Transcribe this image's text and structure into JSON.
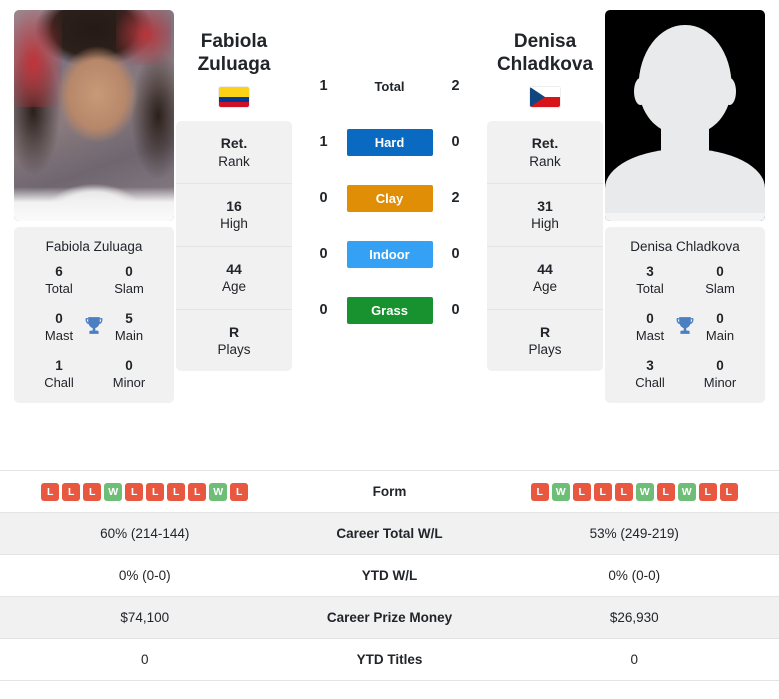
{
  "players": {
    "left": {
      "first_name": "Fabiola",
      "last_name": "Zuluaga",
      "full_name": "Fabiola Zuluaga",
      "flag": "colombia-flag",
      "photo": "player-photo",
      "info": [
        {
          "value": "Ret.",
          "label": "Rank"
        },
        {
          "value": "16",
          "label": "High"
        },
        {
          "value": "44",
          "label": "Age"
        },
        {
          "value": "R",
          "label": "Plays"
        }
      ],
      "titles": [
        {
          "value": "6",
          "label": "Total"
        },
        {
          "value": "0",
          "label": "Slam"
        },
        {
          "value": "0",
          "label": "Mast"
        },
        {
          "value": "5",
          "label": "Main"
        },
        {
          "value": "1",
          "label": "Chall"
        },
        {
          "value": "0",
          "label": "Minor"
        }
      ],
      "form": [
        "L",
        "L",
        "L",
        "W",
        "L",
        "L",
        "L",
        "L",
        "W",
        "L"
      ],
      "career_total_wl": "60% (214-144)",
      "ytd_wl": "0% (0-0)",
      "career_prize_money": "$74,100",
      "ytd_titles": "0"
    },
    "right": {
      "first_name": "Denisa",
      "last_name": "Chladkova",
      "full_name": "Denisa Chladkova",
      "flag": "czech-republic-flag",
      "photo": "player-photo-placeholder",
      "info": [
        {
          "value": "Ret.",
          "label": "Rank"
        },
        {
          "value": "31",
          "label": "High"
        },
        {
          "value": "44",
          "label": "Age"
        },
        {
          "value": "R",
          "label": "Plays"
        }
      ],
      "titles": [
        {
          "value": "3",
          "label": "Total"
        },
        {
          "value": "0",
          "label": "Slam"
        },
        {
          "value": "0",
          "label": "Mast"
        },
        {
          "value": "0",
          "label": "Main"
        },
        {
          "value": "3",
          "label": "Chall"
        },
        {
          "value": "0",
          "label": "Minor"
        }
      ],
      "form": [
        "L",
        "W",
        "L",
        "L",
        "L",
        "W",
        "L",
        "W",
        "L",
        "L"
      ],
      "career_total_wl": "53% (249-219)",
      "ytd_wl": "0% (0-0)",
      "career_prize_money": "$26,930",
      "ytd_titles": "0"
    }
  },
  "head_to_head": [
    {
      "label": "Total",
      "left": "1",
      "right": "2",
      "bar": false,
      "color": ""
    },
    {
      "label": "Hard",
      "left": "1",
      "right": "0",
      "bar": true,
      "color": "#0a69c0"
    },
    {
      "label": "Clay",
      "left": "0",
      "right": "2",
      "bar": true,
      "color": "#e08e06"
    },
    {
      "label": "Indoor",
      "left": "0",
      "right": "0",
      "bar": true,
      "color": "#35a1f5"
    },
    {
      "label": "Grass",
      "left": "0",
      "right": "0",
      "bar": true,
      "color": "#18922f"
    }
  ],
  "stats_rows": [
    {
      "label": "Form",
      "type": "form",
      "shaded": false
    },
    {
      "label": "Career Total W/L",
      "type": "text",
      "shaded": true,
      "key": "career_total_wl"
    },
    {
      "label": "YTD W/L",
      "type": "text",
      "shaded": false,
      "key": "ytd_wl"
    },
    {
      "label": "Career Prize Money",
      "type": "text",
      "shaded": true,
      "key": "career_prize_money"
    },
    {
      "label": "YTD Titles",
      "type": "text",
      "shaded": false,
      "key": "ytd_titles"
    }
  ],
  "icons": {
    "trophy": "🏆"
  },
  "colors": {
    "win": "#6ebe78",
    "loss": "#e8573f",
    "hard": "#0a69c0",
    "clay": "#e08e06",
    "indoor": "#35a1f5",
    "grass": "#18922f",
    "panel": "#f1f1f2",
    "trophy": "#4a7fc1"
  }
}
